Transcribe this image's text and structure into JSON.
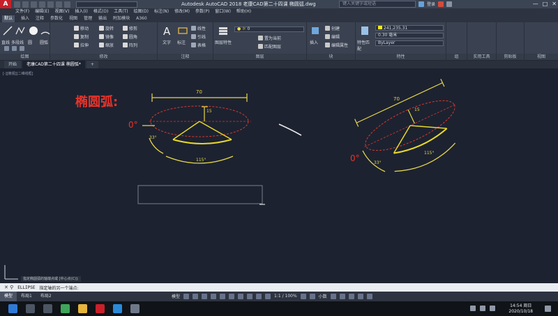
{
  "titlebar": {
    "title": "Autodesk AutoCAD 2018    老康CAD第二十四课 椭圆弧.dwg",
    "search_placeholder": "键入关键字或短语",
    "signin": "登录",
    "controls": [
      "—",
      "□",
      "✕"
    ]
  },
  "menu": [
    "文件(F)",
    "编辑(E)",
    "视图(V)",
    "插入(I)",
    "格式(O)",
    "工具(T)",
    "绘图(D)",
    "标注(N)",
    "修改(M)",
    "参数(P)",
    "窗口(W)",
    "帮助(H)"
  ],
  "ribbon_tabs": [
    "默认",
    "插入",
    "注释",
    "参数化",
    "视图",
    "管理",
    "输出",
    "附加模块",
    "A360"
  ],
  "ribbon": {
    "groups": [
      "绘图",
      "修改",
      "注释",
      "图层",
      "块",
      "特性",
      "组",
      "实用工具",
      "剪贴板",
      "视图"
    ],
    "draw_tools": [
      "直线",
      "多段线",
      "圆",
      "圆弧"
    ],
    "modify_tools": [
      "移动",
      "旋转",
      "修剪",
      "复制",
      "镜像",
      "圆角",
      "拉伸",
      "缩放",
      "阵列"
    ],
    "annotation_tools": [
      "文字",
      "标注",
      "线性",
      "引线",
      "表格"
    ],
    "layer_tools": [
      "图层特性",
      "置为当前",
      "匹配图层"
    ],
    "layer_value": "0",
    "block_tools": [
      "插入",
      "创建",
      "编辑",
      "编辑属性"
    ],
    "properties": {
      "color_value": "241,235,31",
      "lineweight_value": "0.30 毫米",
      "linetype_value": "ByLayer",
      "match_label": "特性匹配",
      "props_label": "特性"
    }
  },
  "file_tabs": [
    "开始",
    "老康CAD第二十四课 椭圆弧*",
    "+"
  ],
  "viewport_label": "[-][俯视][二维线框]",
  "drawing": {
    "heading": "椭圆弧:",
    "dim_70_left": "70",
    "dim_15_left": "15",
    "zero_left": "0°",
    "angle_33_left": "33°",
    "angle_115_left": "115°",
    "dim_70_right": "70",
    "dim_15_right": "15",
    "zero_right": "0°",
    "angle_33_right": "33°",
    "angle_115_right": "115°",
    "colors": {
      "yellow": "#e8d92a",
      "red": "#e0342c",
      "dim": "#e6d84a"
    }
  },
  "command": {
    "history": "指定椭圆弧的轴端点或 [中心点(C)]:",
    "prompt": "ELLIPSE",
    "input": "指定轴的另一个端点:"
  },
  "status": {
    "layout_tabs": [
      "模型",
      "布局1",
      "布局2"
    ],
    "model_label": "模型",
    "scale": "1:1 / 100%",
    "units": "小数"
  },
  "taskbar": {
    "time": "14:54 周日",
    "date": "2020/10/18"
  }
}
